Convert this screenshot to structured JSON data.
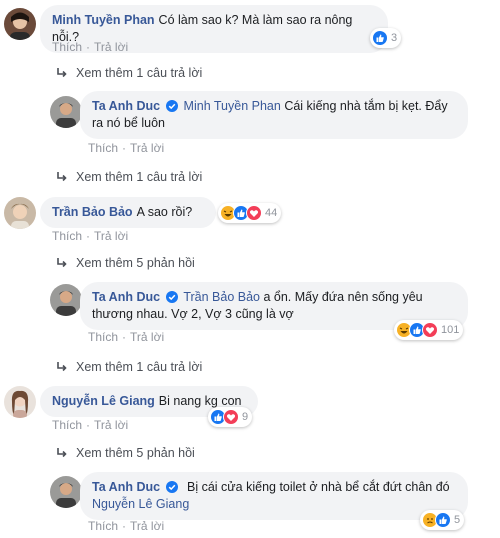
{
  "colors": {
    "link": "#385898",
    "bubble": "#f2f3f5",
    "meta": "#90949c",
    "like": "#1877f2",
    "love": "#f33e58",
    "haha": "#f7b125"
  },
  "actions": {
    "like": "Thích",
    "reply": "Trả lời",
    "sep": "·"
  },
  "threads": [
    {
      "comment": {
        "author": "Minh Tuyền Phan",
        "text": "Có làm sao k? Mà làm sao ra nông nỗi.?",
        "reactions": [
          "like"
        ],
        "count": "3"
      },
      "more": "Xem thêm 1 câu trả lời",
      "reply": {
        "author": "Ta Anh Duc",
        "tag": "Minh Tuyền Phan",
        "text": " Cái kiếng nhà tắm bị kẹt. Đẩy ra nó bể luôn"
      }
    },
    {
      "comment": {
        "author": "Trần Bảo Bảo",
        "text": "A sao rồi?",
        "reactions": [
          "haha",
          "like",
          "love"
        ],
        "count": "44"
      },
      "more_top": "Xem thêm 5 phản hồi",
      "reply": {
        "author": "Ta Anh Duc",
        "tag": "Trần Bảo Bảo",
        "text": " a ổn. Mấy đứa nên sống yêu thương nhau. Vợ 2, Vợ 3 cũng là vợ",
        "reactions": [
          "haha",
          "like",
          "love"
        ],
        "count": "101"
      },
      "more": "Xem thêm 1 câu trả lời"
    },
    {
      "comment": {
        "author": "Nguyễn Lê Giang",
        "text": "Bi nang kg con",
        "reactions": [
          "like",
          "love"
        ],
        "count": "9"
      },
      "more_top": "Xem thêm 5 phản hồi",
      "reply": {
        "author": "Ta Anh Duc",
        "text": "Bị cái cửa kiếng toilet ở nhà bể cắt đứt chân đó",
        "tag": "Nguyễn Lê Giang",
        "reactions": [
          "sad",
          "like"
        ],
        "count": "5"
      }
    }
  ]
}
